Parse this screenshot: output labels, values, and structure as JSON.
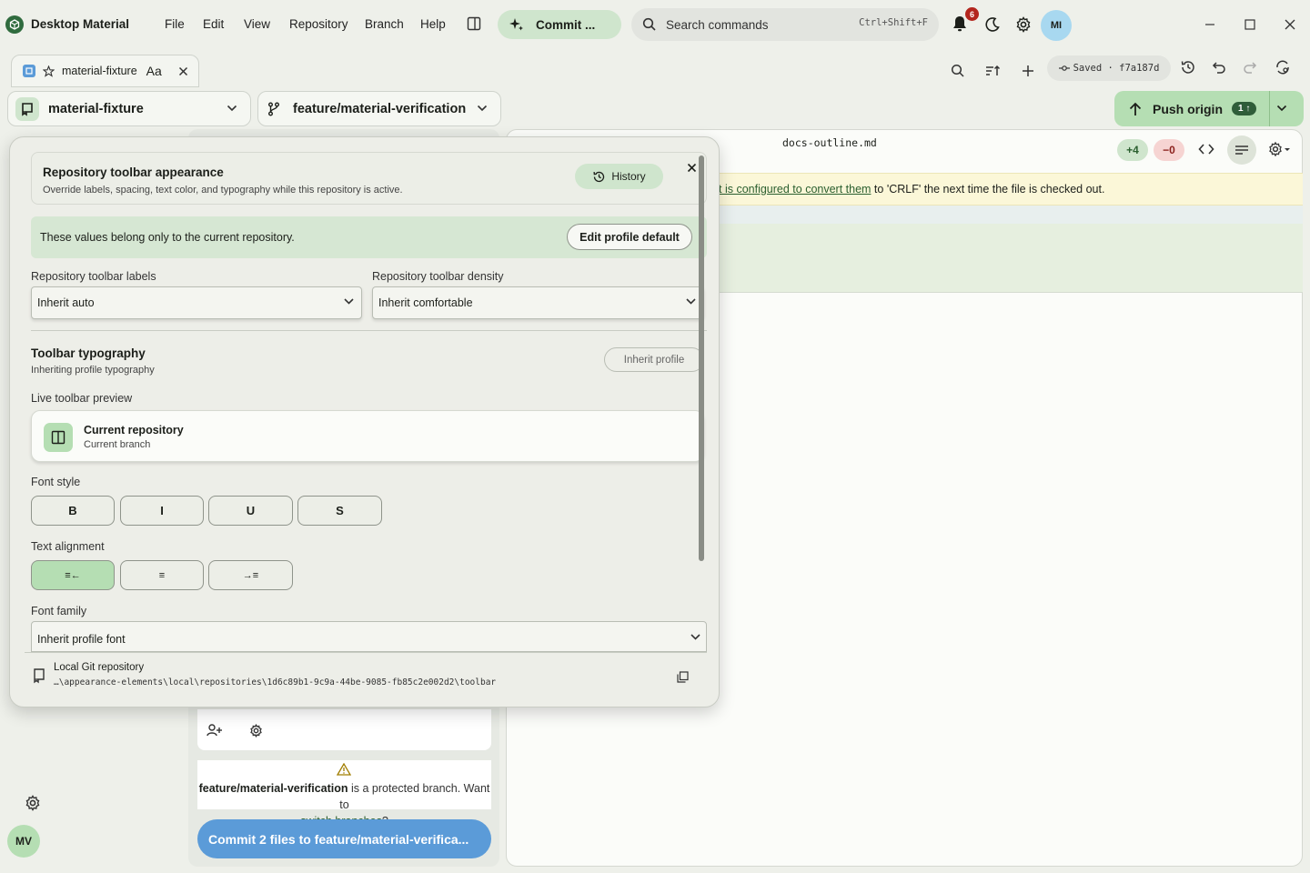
{
  "app": {
    "title": "Desktop Material"
  },
  "menu": [
    "File",
    "Edit",
    "View",
    "Repository",
    "Branch",
    "Help"
  ],
  "commit_pill": "Commit ...",
  "search": {
    "placeholder": "Search commands",
    "shortcut": "Ctrl+Shift+F"
  },
  "notifications": {
    "count": "6"
  },
  "user": {
    "initials": "MI"
  },
  "tab": {
    "label": "material-fixture",
    "font_toggle": "Aa"
  },
  "status": {
    "saved": "Saved · f7a187d"
  },
  "repo_selector": "material-fixture",
  "branch_selector": "feature/material-verification",
  "push": {
    "label": "Push origin",
    "count": "1"
  },
  "diff": {
    "filename": "docs-outline.md",
    "added": "+4",
    "removed": "−0",
    "warning_link": "t is configured to convert them",
    "warning_rest": " to 'CRLF' the next time the file is checked out."
  },
  "overlay": {
    "title": "Repository toolbar appearance",
    "subtitle": "Override labels, spacing, text color, and typography while this repository is active.",
    "history_button": "History",
    "scope_text": "These values belong only to the current repository.",
    "edit_default_button": "Edit profile default",
    "labels_label": "Repository toolbar labels",
    "labels_value": "Inherit auto",
    "density_label": "Repository toolbar density",
    "density_value": "Inherit comfortable",
    "typography_title": "Toolbar typography",
    "typography_sub": "Inheriting profile typography",
    "inherit_button": "Inherit profile",
    "preview_label": "Live toolbar preview",
    "preview_title": "Current repository",
    "preview_sub": "Current branch",
    "font_style_label": "Font style",
    "font_styles": [
      "B",
      "I",
      "U",
      "S"
    ],
    "alignment_label": "Text alignment",
    "alignments": [
      "≡←",
      "≡",
      "→≡"
    ],
    "font_family_label": "Font family",
    "font_family_value": "Inherit profile font",
    "footer_title": "Local Git repository",
    "footer_path": "…\\appearance-elements\\local\\repositories\\1d6c89b1-9c9a-44be-9085-fb85c2e002d2\\toolbar"
  },
  "protected": {
    "branch": "feature/material-verification",
    "text": " is a protected branch. Want to",
    "link": "switch branches",
    "suffix": "?"
  },
  "commit_button": "Commit 2 files to feature/material-verifica...",
  "sidebar_user": "MV",
  "colors": {
    "accent": "#b5deb3",
    "primary_button": "#5b9bd8",
    "warning_bg": "#fbf7d8",
    "badge": "#b3261e"
  }
}
